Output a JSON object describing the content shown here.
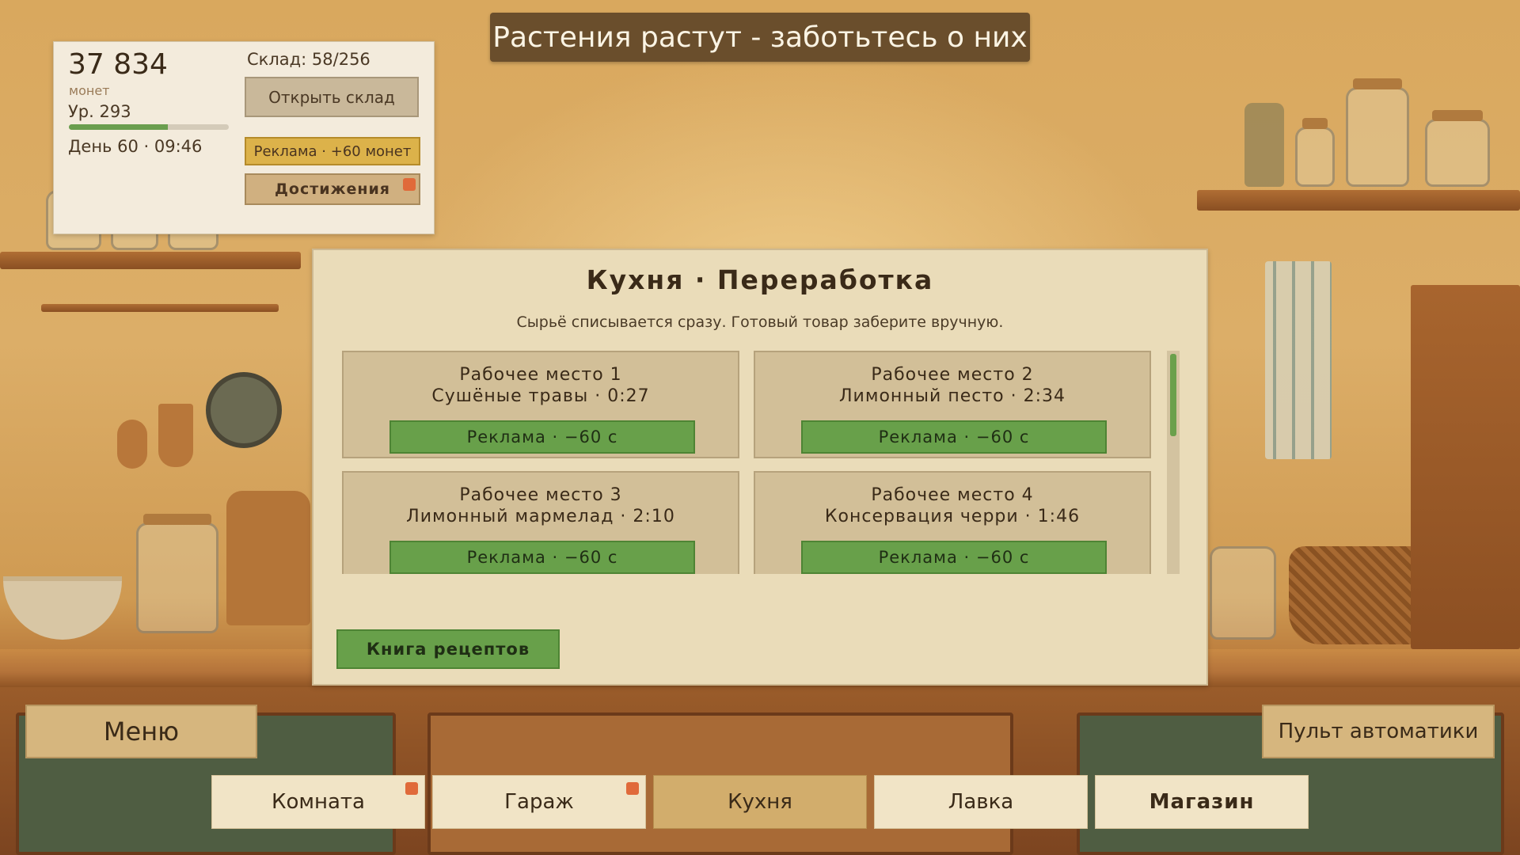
{
  "banner": {
    "text": "Растения растут - заботьтесь о них"
  },
  "status": {
    "coins": "37 834",
    "coins_label": "монет",
    "level": "Ур. 293",
    "xp_fraction": 0.62,
    "daytime": "День 60 · 09:46",
    "storage": "Склад: 58/256",
    "open_storage_label": "Открыть склад",
    "ad_label": "Реклама · +60 монет",
    "achievements_label": "Достижения"
  },
  "kitchen": {
    "title": "Кухня · Переработка",
    "subtitle": "Сырьё списывается сразу. Готовый товар заберите вручную.",
    "stations": [
      {
        "title": "Рабочее место 1",
        "job": "Сушёные травы · 0:27",
        "ad_label": "Реклама · −60 с"
      },
      {
        "title": "Рабочее место 2",
        "job": "Лимонный песто · 2:34",
        "ad_label": "Реклама · −60 с"
      },
      {
        "title": "Рабочее место 3",
        "job": "Лимонный мармелад · 2:10",
        "ad_label": "Реклама · −60 с"
      },
      {
        "title": "Рабочее место 4",
        "job": "Консервация черри · 1:46",
        "ad_label": "Реклама · −60 с"
      }
    ],
    "recipes_label": "Книга рецептов"
  },
  "controls": {
    "menu_label": "Меню",
    "automation_label": "Пульт автоматики"
  },
  "tabs": [
    {
      "label": "Комната",
      "notify": true
    },
    {
      "label": "Гараж",
      "notify": true
    },
    {
      "label": "Кухня",
      "active": true
    },
    {
      "label": "Лавка"
    },
    {
      "label": "Магазин"
    }
  ],
  "colors": {
    "accent_green": "#68a04a",
    "notify_dot": "#e06a3a",
    "banner_bg": "#6a4e2c"
  }
}
